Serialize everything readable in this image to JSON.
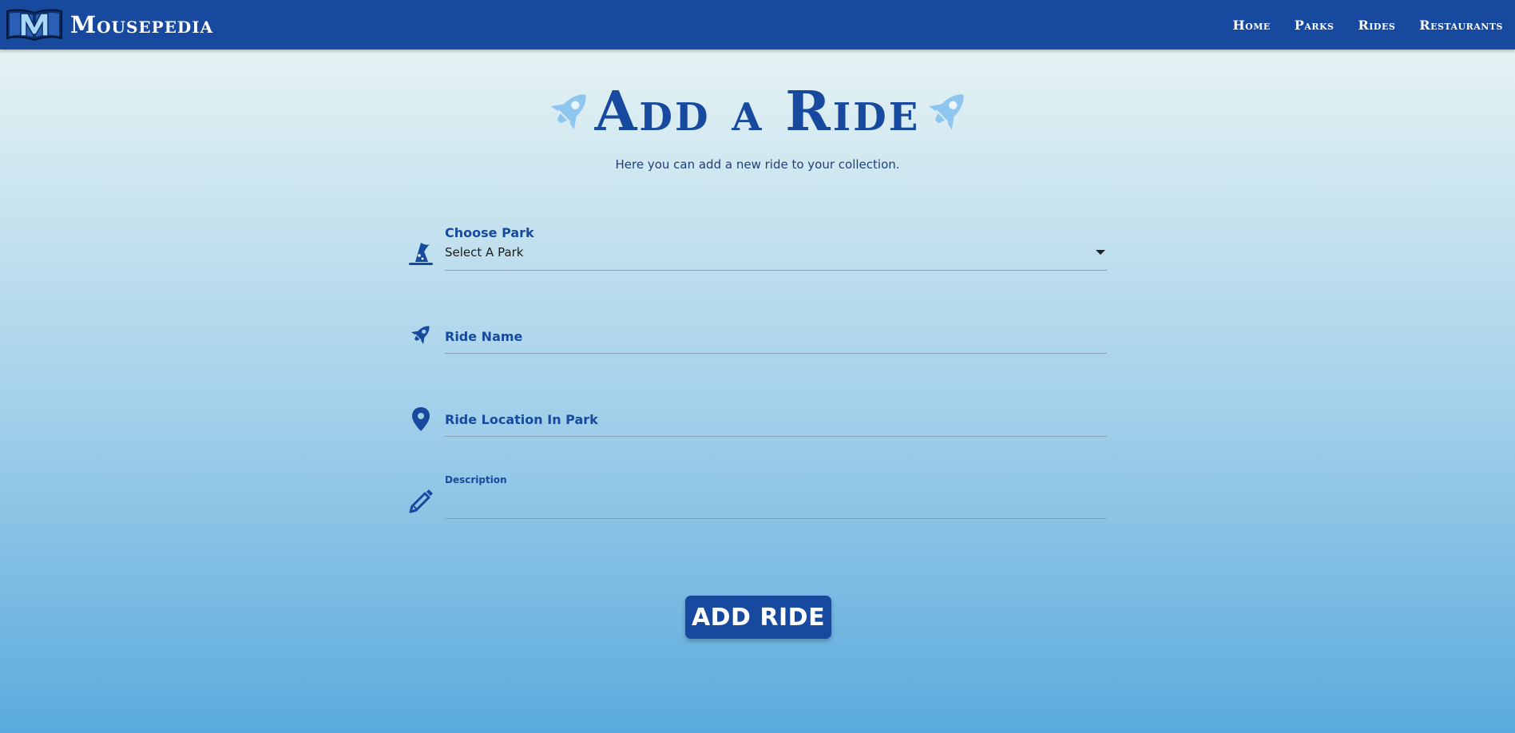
{
  "app": {
    "brand_name": "Mousepedia",
    "brand_logo": "book-m-logo",
    "colors": {
      "primary": "#174a9e",
      "accent": "#8ec6f0"
    }
  },
  "nav": {
    "links": [
      {
        "label": "Home"
      },
      {
        "label": "Parks"
      },
      {
        "label": "Rides"
      },
      {
        "label": "Restaurants"
      }
    ]
  },
  "page": {
    "title": "Add a Ride",
    "title_icon": "rocket-icon",
    "subtitle": "Here you can add a new ride to your collection."
  },
  "form": {
    "park": {
      "label": "Choose Park",
      "value": "Select A Park",
      "icon": "wizard-hat-icon"
    },
    "ride_name": {
      "label": "Ride Name",
      "icon": "rocket-icon"
    },
    "location": {
      "label": "Ride Location In Park",
      "icon": "map-pin-icon"
    },
    "description": {
      "label": "Description",
      "icon": "pencil-icon"
    },
    "submit_label": "ADD RIDE"
  }
}
